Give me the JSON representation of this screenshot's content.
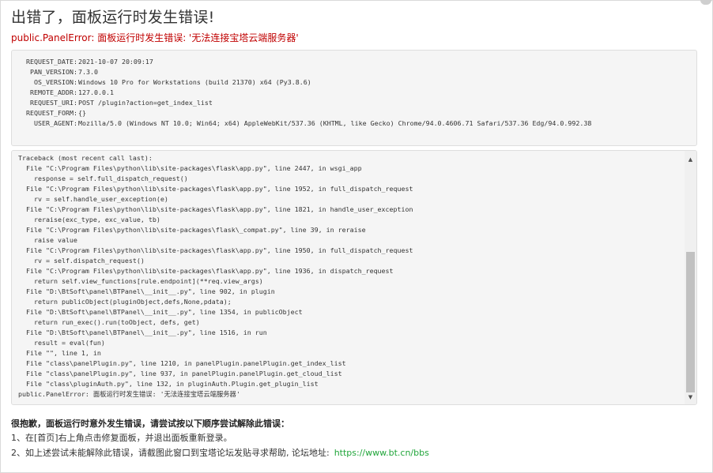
{
  "title": "出错了，面板运行时发生错误!",
  "subtitle": "public.PanelError: 面板运行时发生错误: '无法连接宝塔云端服务器'",
  "request_info": [
    {
      "key": "REQUEST_DATE",
      "value": "2021-10-07 20:09:17"
    },
    {
      "key": "PAN_VERSION",
      "value": "7.3.0"
    },
    {
      "key": "OS_VERSION",
      "value": "Windows 10 Pro for Workstations (build 21370) x64 (Py3.8.6)"
    },
    {
      "key": "REMOTE_ADDR",
      "value": "127.0.0.1"
    },
    {
      "key": "REQUEST_URI",
      "value": "POST /plugin?action=get_index_list"
    },
    {
      "key": "REQUEST_FORM",
      "value": "{}"
    },
    {
      "key": "USER_AGENT",
      "value": "Mozilla/5.0 (Windows NT 10.0; Win64; x64) AppleWebKit/537.36 (KHTML, like Gecko) Chrome/94.0.4606.71 Safari/537.36 Edg/94.0.992.38"
    }
  ],
  "traceback": [
    "Traceback (most recent call last):",
    "  File \"C:\\Program Files\\python\\lib\\site-packages\\flask\\app.py\", line 2447, in wsgi_app",
    "    response = self.full_dispatch_request()",
    "  File \"C:\\Program Files\\python\\lib\\site-packages\\flask\\app.py\", line 1952, in full_dispatch_request",
    "    rv = self.handle_user_exception(e)",
    "  File \"C:\\Program Files\\python\\lib\\site-packages\\flask\\app.py\", line 1821, in handle_user_exception",
    "    reraise(exc_type, exc_value, tb)",
    "  File \"C:\\Program Files\\python\\lib\\site-packages\\flask\\_compat.py\", line 39, in reraise",
    "    raise value",
    "  File \"C:\\Program Files\\python\\lib\\site-packages\\flask\\app.py\", line 1950, in full_dispatch_request",
    "    rv = self.dispatch_request()",
    "  File \"C:\\Program Files\\python\\lib\\site-packages\\flask\\app.py\", line 1936, in dispatch_request",
    "    return self.view_functions[rule.endpoint](**req.view_args)",
    "  File \"D:\\BtSoft\\panel\\BTPanel\\__init__.py\", line 902, in plugin",
    "    return publicObject(pluginObject,defs,None,pdata);",
    "  File \"D:\\BtSoft\\panel\\BTPanel\\__init__.py\", line 1354, in publicObject",
    "    return run_exec().run(toObject, defs, get)",
    "  File \"D:\\BtSoft\\panel\\BTPanel\\__init__.py\", line 1516, in run",
    "    result = eval(fun)",
    "  File \"\", line 1, in",
    "  File \"class\\panelPlugin.py\", line 1210, in panelPlugin.panelPlugin.get_index_list",
    "  File \"class\\panelPlugin.py\", line 937, in panelPlugin.panelPlugin.get_cloud_list",
    "  File \"class\\pluginAuth.py\", line 132, in pluginAuth.Plugin.get_plugin_list",
    "public.PanelError: 面板运行时发生错误: '无法连接宝塔云端服务器'"
  ],
  "help": {
    "heading": "很抱歉，面板运行时意外发生错误，请尝试按以下顺序尝试解除此错误：",
    "step1": "1、在[首页]右上角点击修复面板，并退出面板重新登录。",
    "step2": "2、如上述尝试未能解除此错误，请截图此窗口到宝塔论坛发贴寻求帮助, 论坛地址:",
    "forum_url": "https://www.bt.cn/bbs"
  },
  "scrollbar": {
    "up_icon": "triangle-up",
    "down_icon": "triangle-down"
  }
}
